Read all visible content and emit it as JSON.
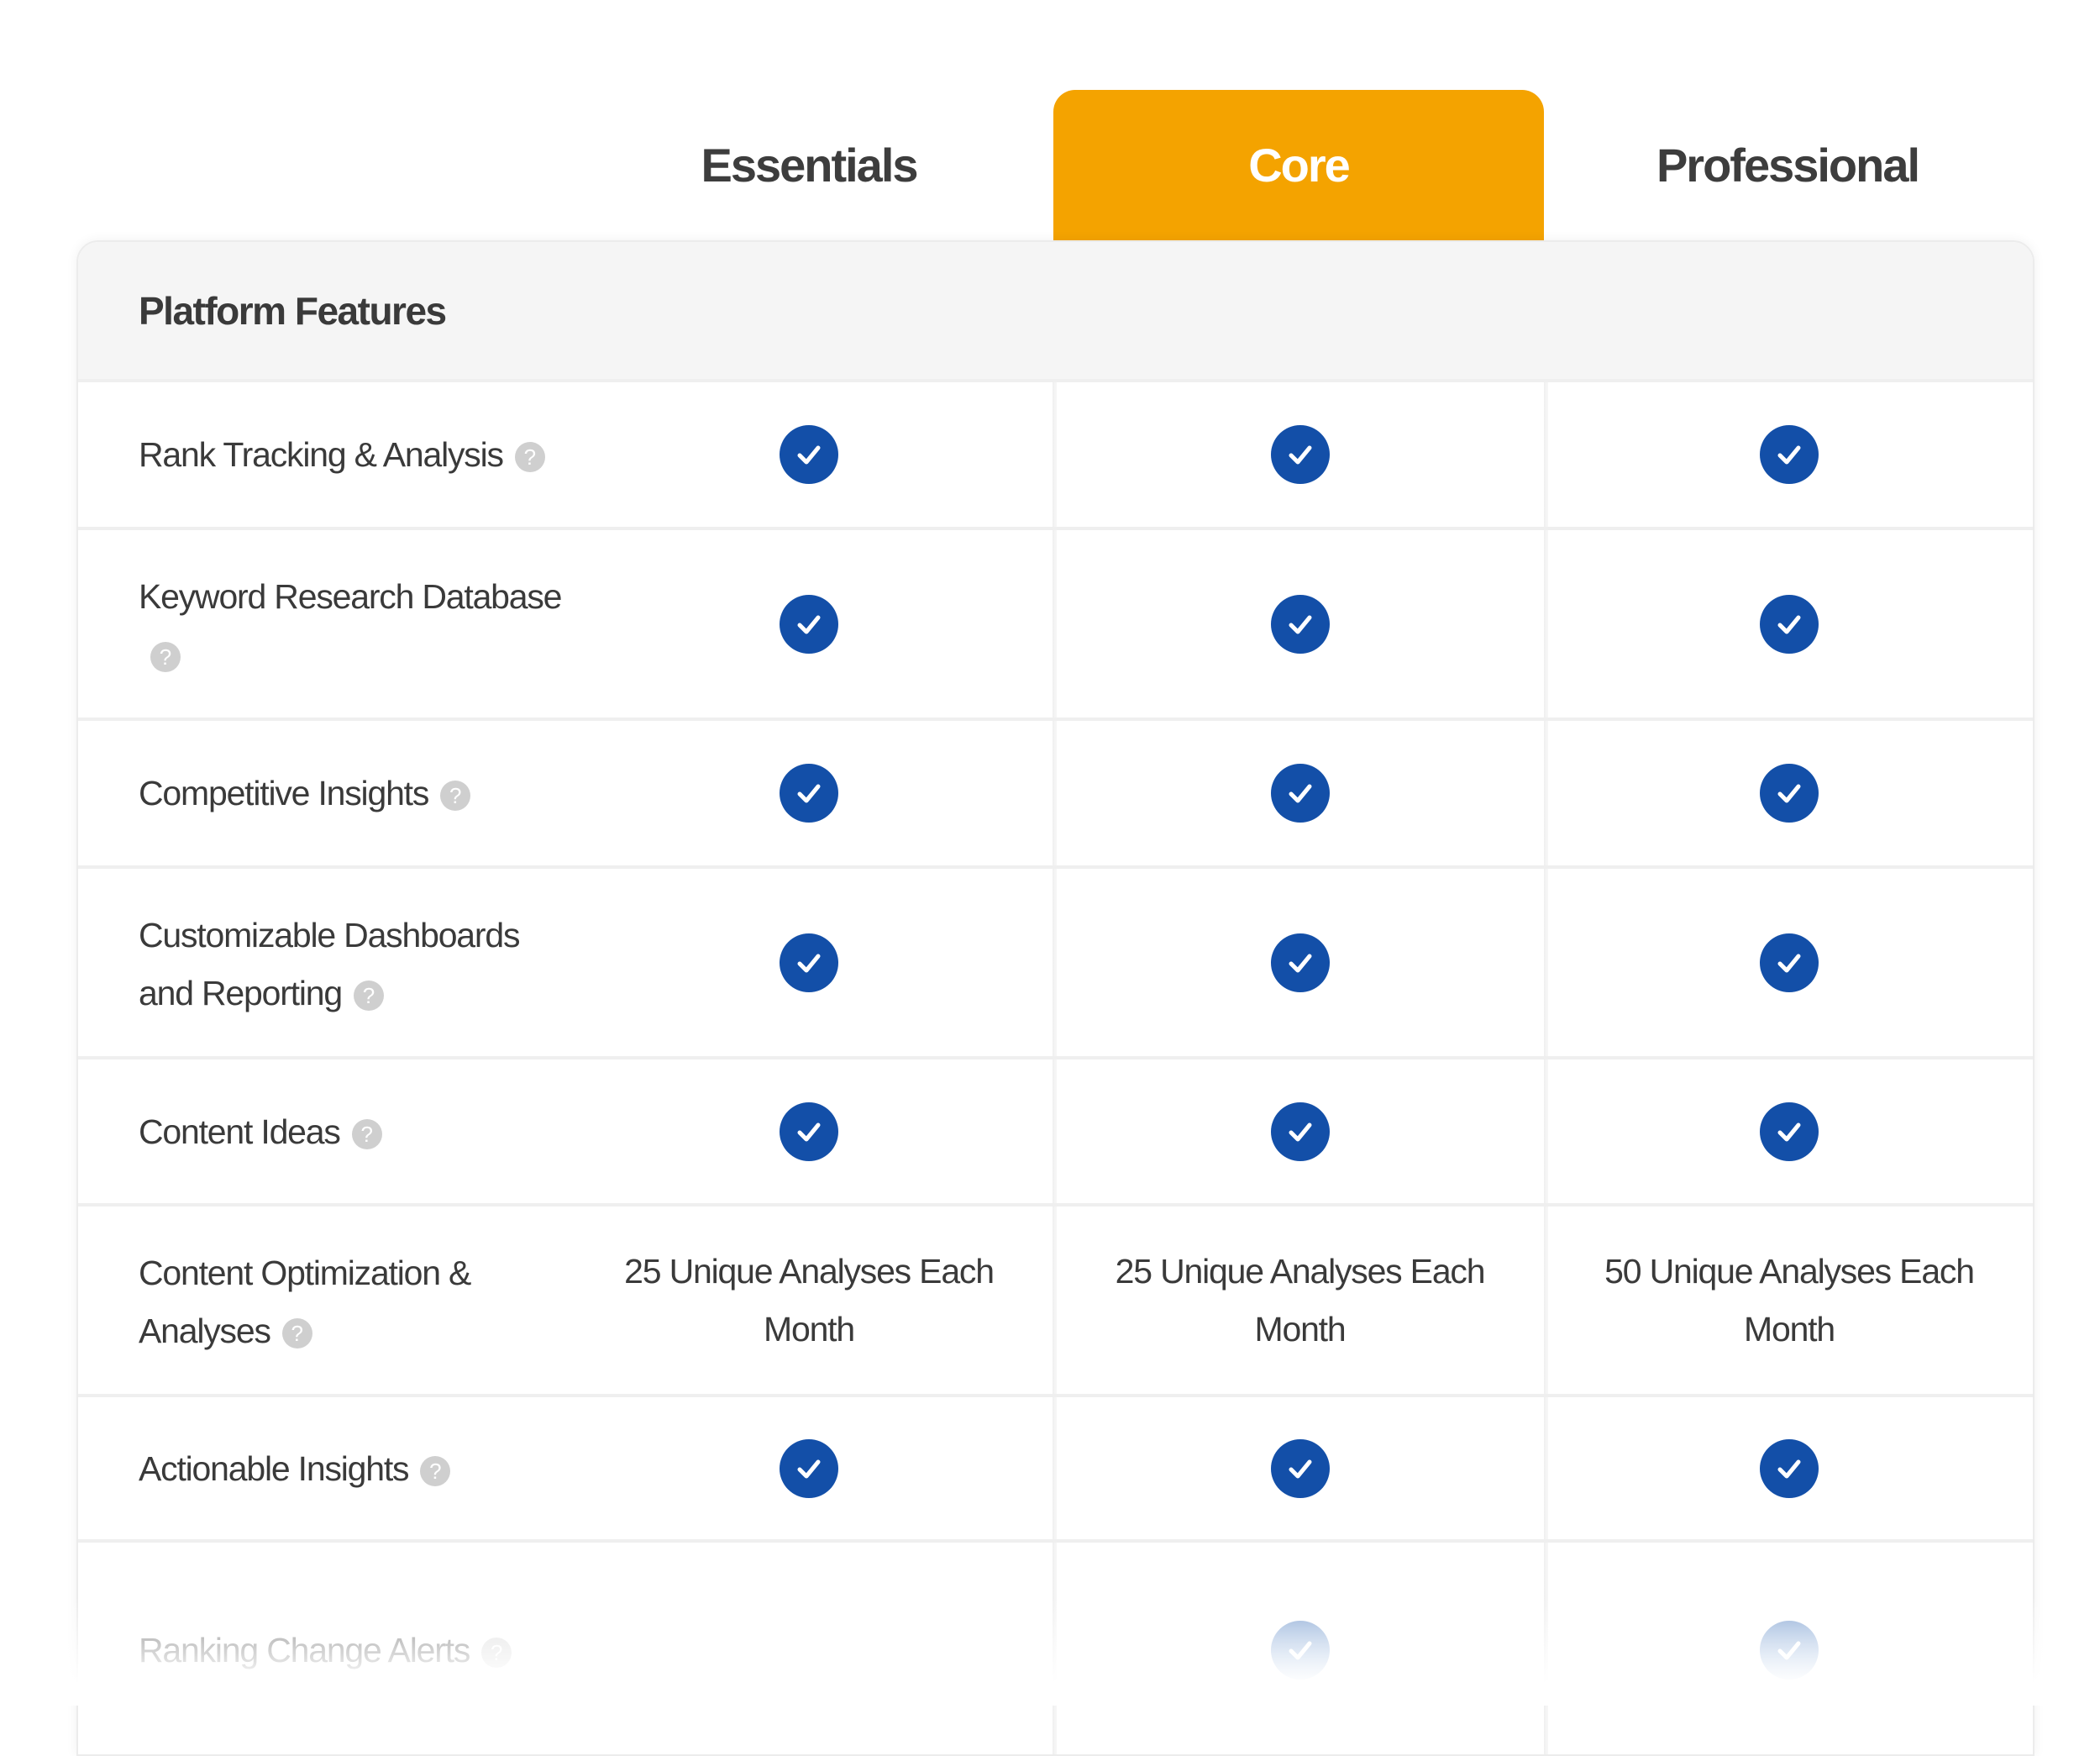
{
  "plans": [
    "Essentials",
    "Core",
    "Professional"
  ],
  "highlight_color": "#f4a300",
  "check_color": "#134fa8",
  "section_title": "Platform Features",
  "help_icon_glyph": "?",
  "features": [
    {
      "label": "Rank Tracking & Analysis",
      "values": [
        "check",
        "check",
        "check"
      ]
    },
    {
      "label": "Keyword Research Database",
      "values": [
        "check",
        "check",
        "check"
      ]
    },
    {
      "label": "Competitive Insights",
      "values": [
        "check",
        "check",
        "check"
      ]
    },
    {
      "label": "Customizable Dashboards and Reporting",
      "values": [
        "check",
        "check",
        "check"
      ]
    },
    {
      "label": "Content Ideas",
      "values": [
        "check",
        "check",
        "check"
      ]
    },
    {
      "label": "Content Optimization & Analyses",
      "values": [
        "25 Unique Analyses Each Month",
        "25 Unique Analyses Each Month",
        "50 Unique Analyses Each Month"
      ]
    },
    {
      "label": "Actionable Insights",
      "values": [
        "check",
        "check",
        "check"
      ]
    },
    {
      "label": "Ranking Change Alerts",
      "values": [
        "",
        "check",
        "check"
      ]
    }
  ]
}
